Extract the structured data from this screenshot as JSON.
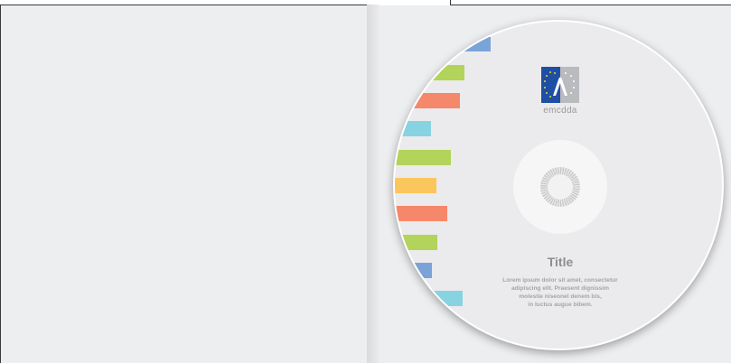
{
  "disc": {
    "logo_text": "emcdda",
    "title": "Title",
    "body_lines": [
      "Lorem ipsum dolor sit amet, consectetur",
      "adipiscing elit. Praesent dignissim",
      "molestie niseonel denem bis,",
      "in luctus augue bibem."
    ]
  },
  "colors": {
    "blue": "#7aa3d8",
    "green": "#b2d45a",
    "orange": "#f5876a",
    "cyan": "#88d3e1",
    "yellow": "#fbc65b",
    "logo_blue": "#1f4fa3",
    "logo_gray": "#b9bbbf"
  }
}
